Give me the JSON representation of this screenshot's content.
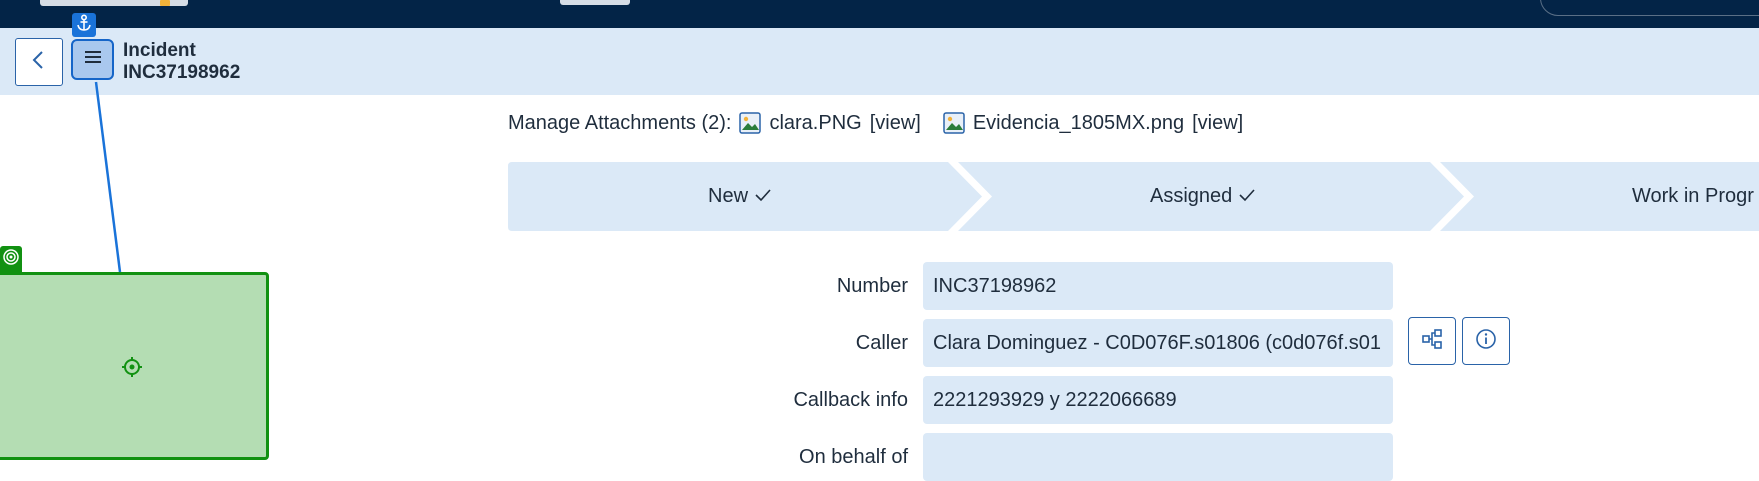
{
  "header": {
    "record_type": "Incident",
    "record_number": "INC37198962"
  },
  "attachments": {
    "label": "Manage Attachments (2):",
    "files": [
      {
        "name": "clara.PNG",
        "view_label": "[view]"
      },
      {
        "name": "Evidencia_1805MX.png",
        "view_label": "[view]"
      }
    ]
  },
  "stages": [
    {
      "label": "New",
      "status": "complete"
    },
    {
      "label": "Assigned",
      "status": "complete"
    },
    {
      "label": "Work in Progr",
      "status": "current"
    }
  ],
  "form": {
    "number": {
      "label": "Number",
      "value": "INC37198962"
    },
    "caller": {
      "label": "Caller",
      "value": "Clara Dominguez - C0D076F.s01806 (c0d076f.s01"
    },
    "callback_info": {
      "label": "Callback info",
      "value": " 2221293929 y 2222066689"
    },
    "on_behalf_of": {
      "label": "On behalf of",
      "value": ""
    }
  },
  "icons": {
    "back": "chevron-left-icon",
    "menu": "hamburger-menu-icon",
    "anchor": "anchor-icon",
    "target": "target-icon",
    "crosshair": "crosshair-icon",
    "attachment": "image-file-icon",
    "check": "checkmark-icon",
    "reference_tree": "hierarchy-icon",
    "info": "info-icon"
  },
  "colors": {
    "topbar": "#032447",
    "header_bg": "#dbe9f7",
    "accent_blue": "#1565c8",
    "target_green": "#119111",
    "target_fill": "#b4ddb3",
    "field_bg": "#dbe9f7"
  }
}
